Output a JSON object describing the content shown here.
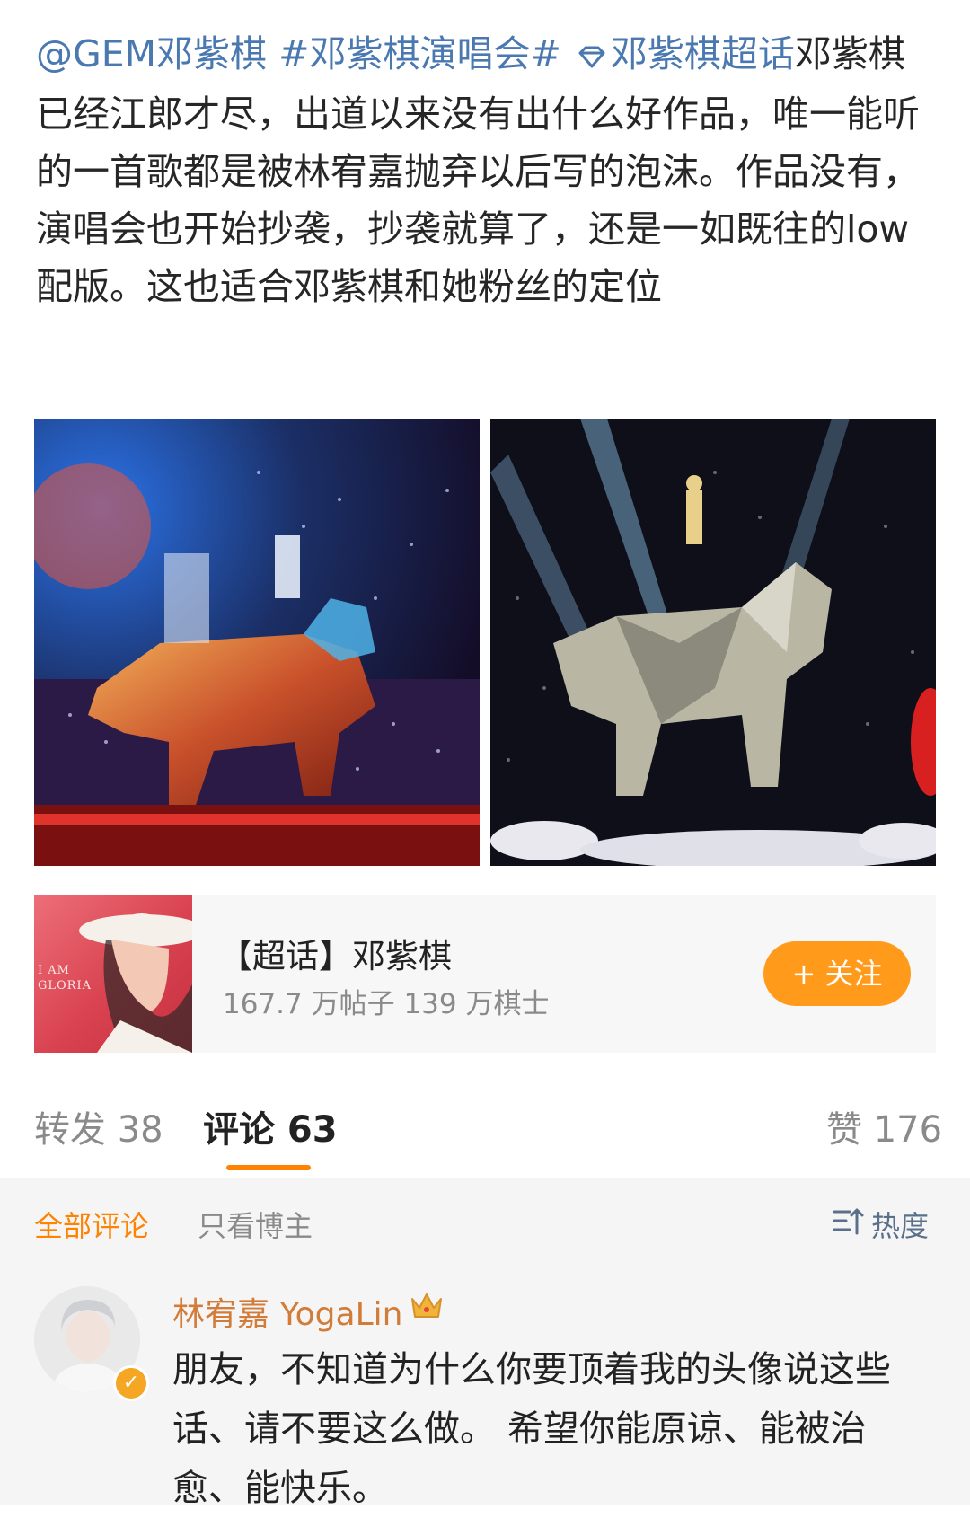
{
  "post": {
    "mention": "@GEM邓紫棋",
    "hashtag": "#邓紫棋演唱会#",
    "supertopic": "邓紫棋超话",
    "body": "邓紫棋已经江郎才尽，出道以来没有出什么好作品，唯一能听的一首歌都是被林宥嘉抛弃以后写的泡沫。作品没有，演唱会也开始抄袭，抄袭就算了，还是一如既往的low配版。这也适合邓紫棋和她粉丝的定位"
  },
  "topic_card": {
    "title": "【超话】邓紫棋",
    "stats": "167.7 万帖子 139 万棋士",
    "follow_label": "+ 关注",
    "cover_text": "I AM GLORIA"
  },
  "tabs": {
    "repost": "转发 38",
    "comment": "评论 63",
    "like": "赞 176"
  },
  "filters": {
    "all": "全部评论",
    "owner_only": "只看博主",
    "sort": "热度"
  },
  "comment": {
    "author": "林宥嘉 YogaLin",
    "text": "朋友，不知道为什么你要顶着我的头像说这些话、请不要这么做。 希望你能原谅、能被治愈、能快乐。"
  },
  "colors": {
    "link": "#4a78b0",
    "accent_orange": "#ff8200",
    "follow_button": "#ff9a1a"
  },
  "icons": [
    "supertopic-diamond-icon",
    "sort-icon",
    "crown-icon",
    "verified-badge-icon"
  ]
}
